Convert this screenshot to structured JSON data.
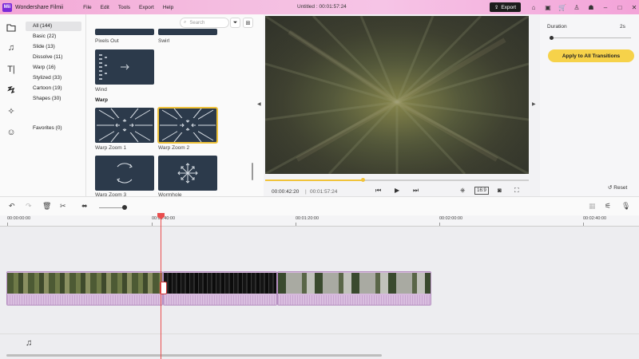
{
  "app": {
    "name": "Wondershare Filmii",
    "logo_text": "Mii",
    "document": "Untitled :   00:01:57:24"
  },
  "menu": [
    "File",
    "Edit",
    "Tools",
    "Export",
    "Help"
  ],
  "export_label": "Export",
  "rail_icons": [
    "folder-icon",
    "music-note-icon",
    "text-icon",
    "transition-icon",
    "effects-icon",
    "sticker-icon"
  ],
  "categories": [
    {
      "label": "All (144)",
      "active": true
    },
    {
      "label": "Basic (22)"
    },
    {
      "label": "Slide (13)"
    },
    {
      "label": "Dissolve (11)"
    },
    {
      "label": "Warp (16)"
    },
    {
      "label": "Stylized (33)"
    },
    {
      "label": "Cartoon (19)"
    },
    {
      "label": "Shapes (30)"
    },
    {
      "label": "Favorites (0)"
    }
  ],
  "library": {
    "search_placeholder": "Search",
    "top_labels": [
      "Pixels Out",
      "Swirl"
    ],
    "wind_label": "Wind",
    "section": "Warp",
    "items": [
      "Warp Zoom 1",
      "Warp Zoom 2",
      "Warp Zoom 3",
      "Wormhole"
    ],
    "selected": "Warp Zoom 2"
  },
  "player": {
    "current": "00:00:42:20",
    "separator": "|",
    "total": "00:01:57:24",
    "ratio": "16:9",
    "progress": 0.37
  },
  "properties": {
    "duration_label": "Duration",
    "duration_value": "2s",
    "apply_label": "Apply to All Transitions",
    "reset_label": "Reset",
    "duration_level": 0.0
  },
  "ruler": [
    "00:00:00:00",
    "00:00:40:00",
    "00:01:20:00",
    "00:02:00:00",
    "00:02:40:00"
  ],
  "colors": {
    "accent": "#f0c33a",
    "playhead": "#e94e4e",
    "clip": "#d6b9dc"
  }
}
